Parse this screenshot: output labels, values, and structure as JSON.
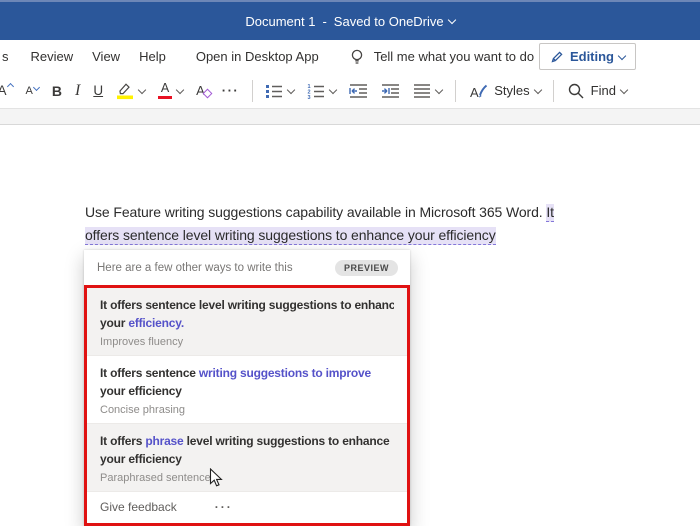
{
  "titlebar": {
    "doc": "Document 1",
    "sep": "-",
    "status": "Saved to OneDrive"
  },
  "tabs": {
    "partial": "s",
    "review": "Review",
    "view": "View",
    "help": "Help",
    "open_desktop": "Open in Desktop App",
    "tell_me": "Tell me what you want to do",
    "editing": "Editing"
  },
  "toolbar": {
    "styles": "Styles",
    "find": "Find",
    "more": "···"
  },
  "document": {
    "line1": "Use Feature writing suggestions capability available in Microsoft 365 Word. ",
    "line1_hl": "It",
    "line2_hl": "offers sentence level writing suggestions to enhance your efficiency"
  },
  "popup": {
    "header": "Here are a few other ways to write this",
    "badge": "PREVIEW",
    "suggestions": [
      {
        "shaded": true,
        "label": "Improves fluency",
        "parts": [
          {
            "t": "It offers sentence level writing suggestions to enhance"
          },
          {
            "br": true
          },
          {
            "t": "your "
          },
          {
            "t": "efficiency.",
            "hl": true
          }
        ]
      },
      {
        "shaded": false,
        "label": "Concise phrasing",
        "parts": [
          {
            "t": "It offers sentence "
          },
          {
            "t": "writing suggestions to improve",
            "hl": true
          },
          {
            "br": true
          },
          {
            "t": "your efficiency"
          }
        ]
      },
      {
        "shaded": true,
        "label": "Paraphrased sentence",
        "parts": [
          {
            "t": "It offers "
          },
          {
            "t": "phrase",
            "hl": true
          },
          {
            "t": " level writing suggestions to enhance"
          },
          {
            "br": true
          },
          {
            "t": "your efficiency"
          }
        ]
      }
    ],
    "feedback": "Give feedback",
    "more_dots": "···"
  },
  "colors": {
    "brand_blue": "#2b579a",
    "suggestion_purple": "#5552c9",
    "annotation_red": "#e01212",
    "selection_lavender": "#e6e1f6",
    "highlight_yellow": "#fff200",
    "font_color_red": "#e81123"
  }
}
